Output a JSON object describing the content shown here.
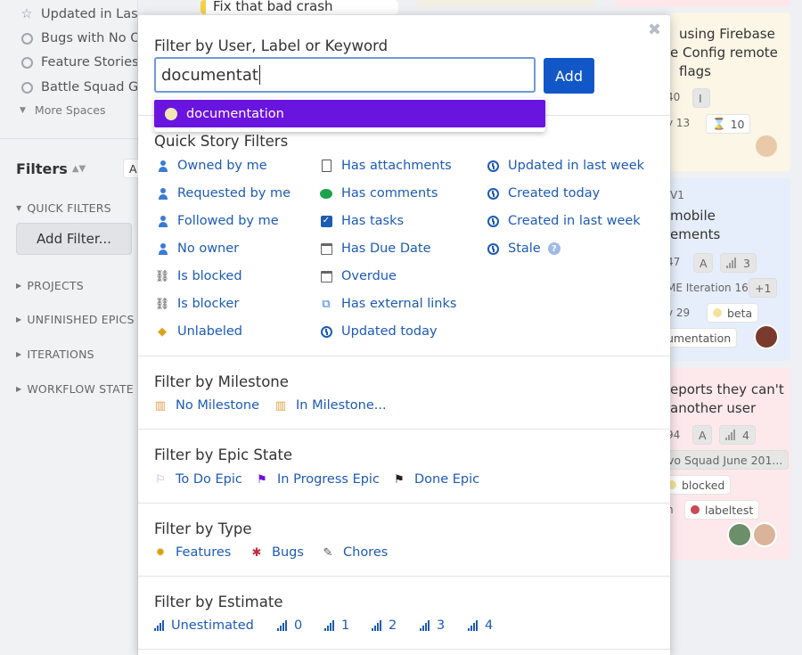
{
  "sidebar": {
    "spaces": [
      {
        "label": "Updated in Last Week",
        "icon": "star-icon"
      },
      {
        "label": "Bugs with No O",
        "icon": "radio-icon"
      },
      {
        "label": "Feature Stories",
        "icon": "radio-icon"
      },
      {
        "label": "Battle Squad Ga",
        "icon": "radio-icon"
      }
    ],
    "more_spaces": "More Spaces",
    "filters_title": "Filters",
    "quick_filters": "QUICK FILTERS",
    "add_filter": "Add Filter...",
    "sections": [
      "PROJECTS",
      "UNFINISHED EPICS",
      "ITERATIONS",
      "WORKFLOW STATE"
    ]
  },
  "board": {
    "top_card_text": "Fix that bad crash",
    "card1": {
      "line1": "using Firebase",
      "line2": "e Config remote",
      "line3": "flags",
      "chip1": "40",
      "chip2": "I",
      "chip3": "y 13",
      "chip4": "10"
    },
    "card2": {
      "prefix": "V1",
      "line1": "mobile",
      "line2": "ements",
      "chip1": "47",
      "chip2": "A",
      "chip3": "3",
      "chip4": "ME Iteration 16",
      "chip5": "+1",
      "chip6": "y 29",
      "chip7": "beta",
      "chip8": "umentation"
    },
    "card3": {
      "line1": "eports they can't",
      "line2": "another user",
      "chip1": "94",
      "chip2": "A",
      "chip3": "4",
      "chip4": "vo Squad June 201...",
      "chip5": "blocked",
      "chip6": "n",
      "chip7": "labeltest"
    }
  },
  "popup": {
    "keyword_title": "Filter by User, Label or Keyword",
    "input_value": "documentat",
    "add_label": "Add",
    "suggestion": "documentation",
    "quick_title": "Quick Story Filters",
    "quick_col1": [
      "Owned by me",
      "Requested by me",
      "Followed by me",
      "No owner",
      "Is blocked",
      "Is blocker",
      "Unlabeled"
    ],
    "quick_col2": [
      "Has attachments",
      "Has comments",
      "Has tasks",
      "Has Due Date",
      "Overdue",
      "Has external links",
      "Updated today"
    ],
    "quick_col3": [
      "Updated in last week",
      "Created today",
      "Created in last week",
      "Stale"
    ],
    "milestone_title": "Filter by Milestone",
    "milestone_opts": [
      "No Milestone",
      "In Milestone..."
    ],
    "epic_title": "Filter by Epic State",
    "epic_opts": [
      "To Do Epic",
      "In Progress Epic",
      "Done Epic"
    ],
    "type_title": "Filter by Type",
    "type_opts": [
      "Features",
      "Bugs",
      "Chores"
    ],
    "estimate_title": "Filter by Estimate",
    "estimate_opts": [
      "Unestimated",
      "0",
      "1",
      "2",
      "3",
      "4"
    ]
  },
  "colors": {
    "accent": "#1257c7",
    "suggestion_bg": "#6a14e0",
    "link": "#1d5bb5"
  }
}
